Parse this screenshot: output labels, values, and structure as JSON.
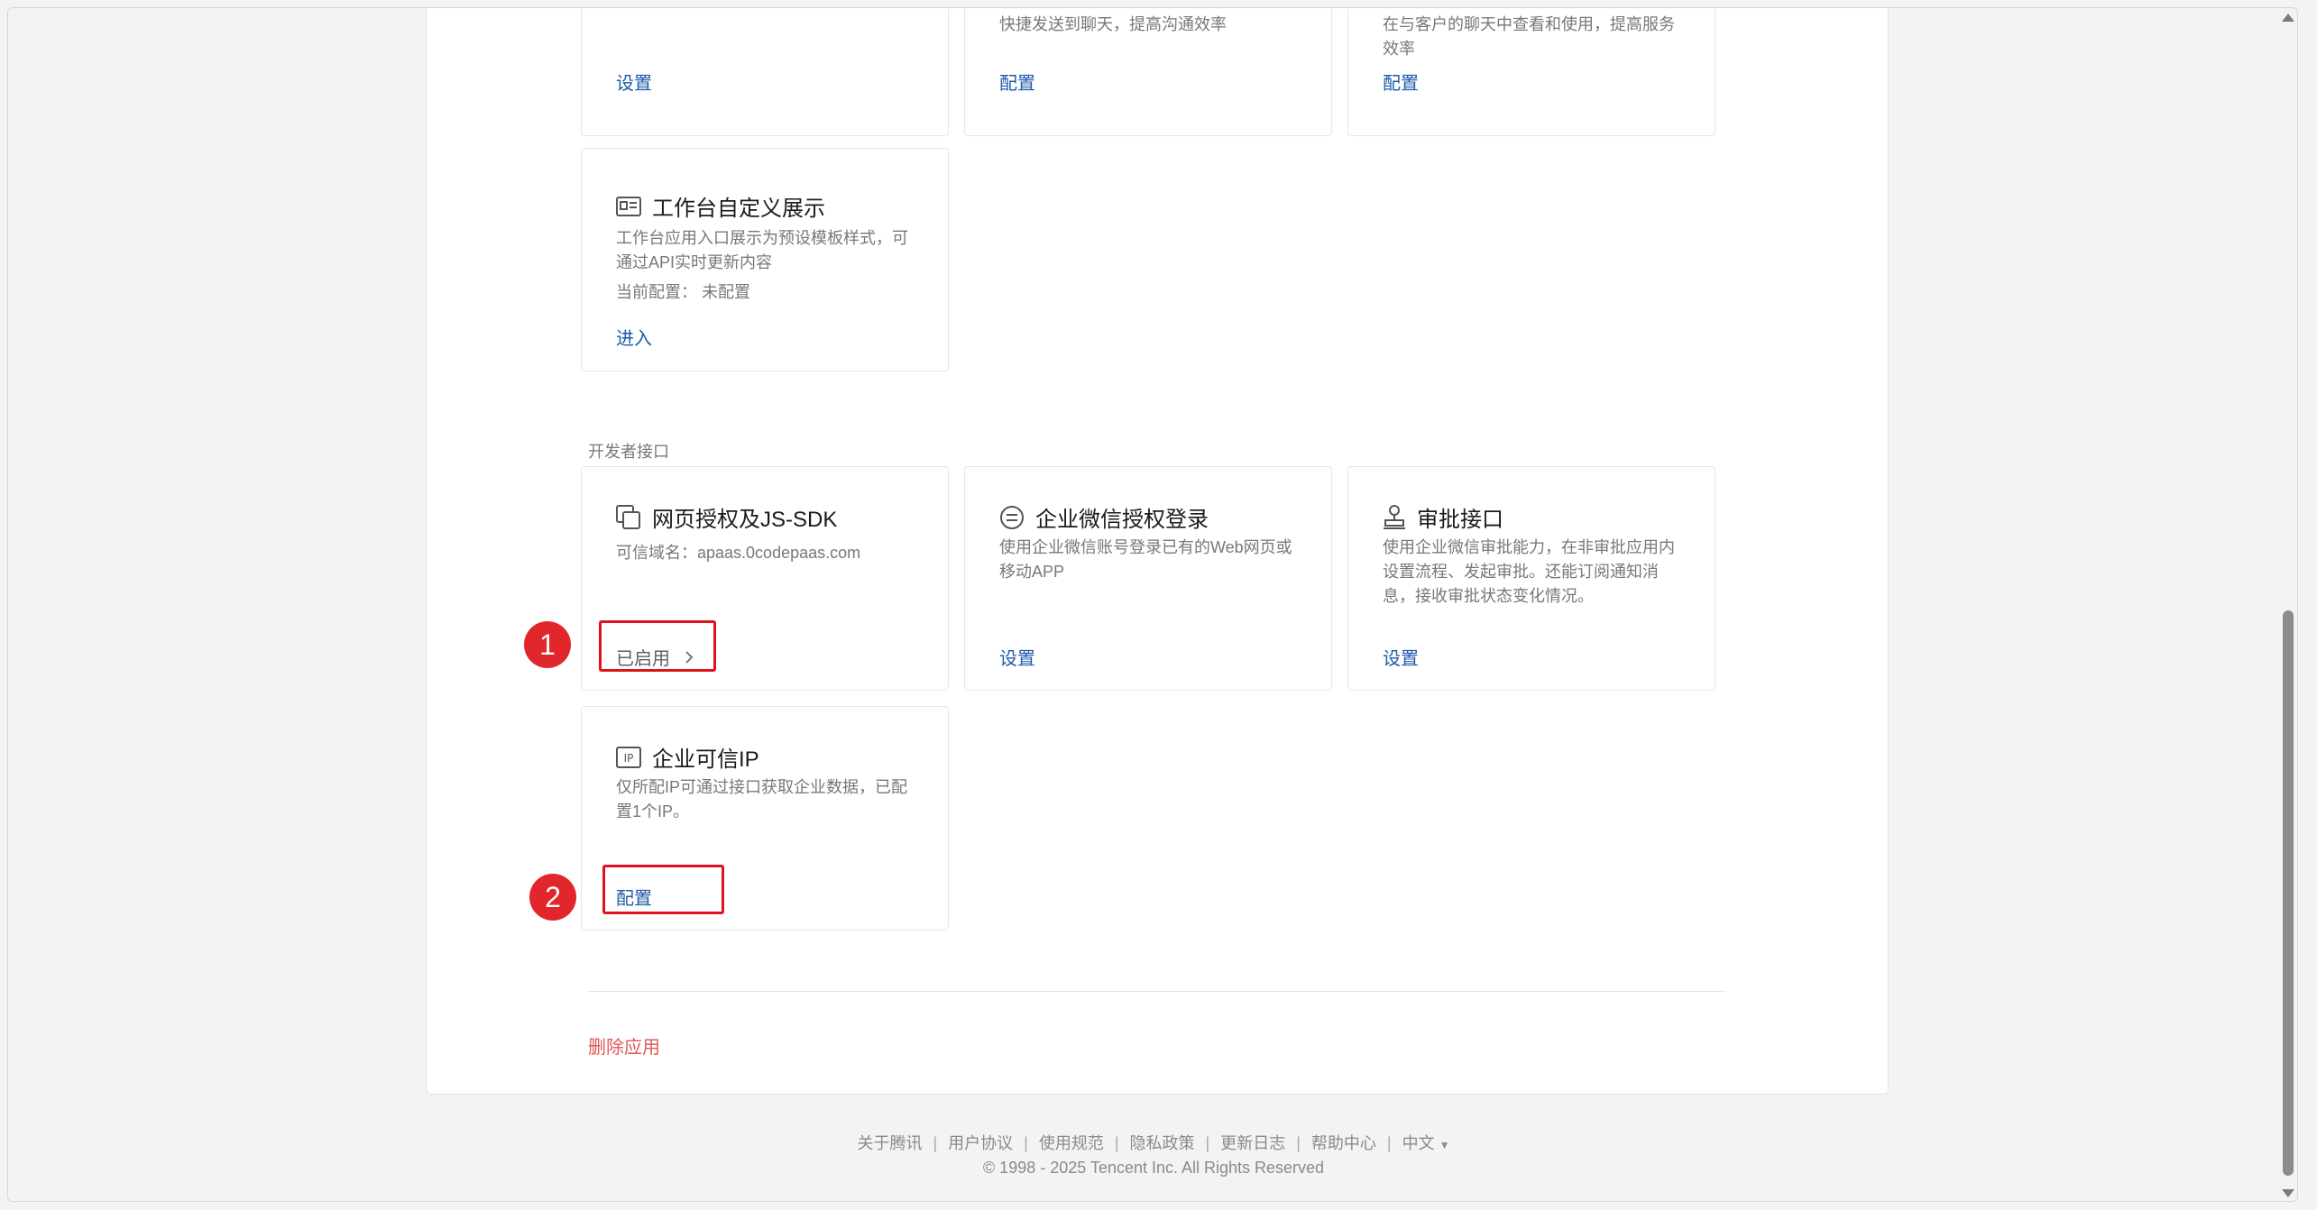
{
  "top_row": {
    "card1": {
      "link": "设置"
    },
    "card2": {
      "desc_tail": "快捷发送到聊天，提高沟通效率",
      "link": "配置"
    },
    "card3": {
      "desc_tail_line1": "在与客户的聊天中查看和使用，提高服务",
      "desc_tail_line2": "效率",
      "link": "配置"
    }
  },
  "workbench": {
    "title": "工作台自定义展示",
    "desc_line1": "工作台应用入口展示为预设模板样式，可",
    "desc_line2": "通过API实时更新内容",
    "current": "当前配置： 未配置",
    "link": "进入"
  },
  "developer": {
    "section_label": "开发者接口",
    "jssdk": {
      "title": "网页授权及JS-SDK",
      "desc": "可信域名：apaas.0codepaas.com",
      "status": "已启用"
    },
    "wework_login": {
      "title": "企业微信授权登录",
      "desc_line1": "使用企业微信账号登录已有的Web网页或",
      "desc_line2": "移动APP",
      "link": "设置"
    },
    "approval": {
      "title": "审批接口",
      "desc_line1": "使用企业微信审批能力，在非审批应用内",
      "desc_line2": "设置流程、发起审批。还能订阅通知消",
      "desc_line3": "息，接收审批状态变化情况。",
      "link": "设置"
    },
    "trusted_ip": {
      "title": "企业可信IP",
      "desc_line1": "仅所配IP可通过接口获取企业数据，已配",
      "desc_line2": "置1个IP。",
      "link": "配置"
    }
  },
  "annotations": {
    "marker1": "1",
    "marker2": "2",
    "highlight_color": "#e0101c"
  },
  "delete_app": "删除应用",
  "footer": {
    "links": [
      "关于腾讯",
      "用户协议",
      "使用规范",
      "隐私政策",
      "更新日志",
      "帮助中心"
    ],
    "language": "中文",
    "copyright": "© 1998 - 2025 Tencent Inc. All Rights Reserved"
  },
  "colors": {
    "link": "#1e5aa8",
    "danger": "#e05757",
    "marker": "#e1262c"
  }
}
